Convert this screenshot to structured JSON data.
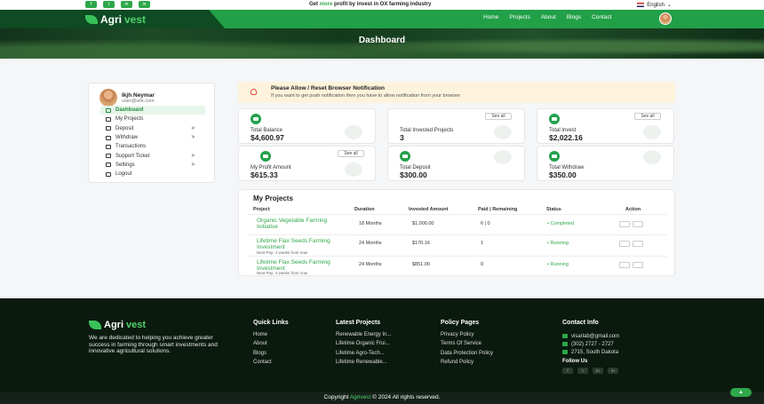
{
  "topbar": {
    "social": [
      "f",
      "t",
      "in",
      "in"
    ],
    "promo_prefix": "Get ",
    "promo_highlight": "more",
    "promo_suffix": " profit by invest in OX farming industry",
    "language": "English"
  },
  "nav": {
    "logo_a": "Agri",
    "logo_b": "vest",
    "links": [
      "Home",
      "Projects",
      "About",
      "Blogs",
      "Contact"
    ]
  },
  "hero": {
    "title": "Dashboard"
  },
  "sidebar": {
    "name": "Ikjh Neymar",
    "email": "user@site.com",
    "items": [
      {
        "label": "Dashboard",
        "chev": ""
      },
      {
        "label": "My Projects",
        "chev": ""
      },
      {
        "label": "Deposit",
        "chev": ">"
      },
      {
        "label": "Withdraw",
        "chev": ">"
      },
      {
        "label": "Transactions",
        "chev": ""
      },
      {
        "label": "Support Ticket",
        "chev": ">"
      },
      {
        "label": "Settings",
        "chev": ">"
      },
      {
        "label": "Logout",
        "chev": ""
      }
    ]
  },
  "alert": {
    "title": "Please Allow / Reset Browser Notification",
    "text": "If you want to get push notification then you have to allow notification from your browser"
  },
  "see_all": "See all",
  "cards": [
    {
      "label": "Total Balance",
      "value": "$4,600.97"
    },
    {
      "label": "Total Invested Projects",
      "value": "3"
    },
    {
      "label": "Total Invest",
      "value": "$2,022.16"
    },
    {
      "label": "My Profit Amount",
      "value": "$615.33"
    },
    {
      "label": "Total Deposit",
      "value": "$300.00"
    },
    {
      "label": "Total Withdraw",
      "value": "$350.00"
    }
  ],
  "projects": {
    "title": "My Projects",
    "headers": [
      "Project",
      "Duration",
      "Invested Amount",
      "Paid | Remaining",
      "Status",
      "Action"
    ],
    "rows": [
      {
        "name": "Organic Vegetable Farming Initiative",
        "next": "",
        "duration": "18 Months",
        "amount": "$1,000.00",
        "paid": "6 | 0",
        "status": "Completed"
      },
      {
        "name": "Lifetime Flax Seeds Farming Investment",
        "next": "Next Pay: 4 weeks from now",
        "duration": "24 Months",
        "amount": "$170.16",
        "paid": "1",
        "status": "Running"
      },
      {
        "name": "Lifetime Flax Seeds Farming Investment",
        "next": "Next Pay: 4 weeks from now",
        "duration": "24 Months",
        "amount": "$851.00",
        "paid": "0",
        "status": "Running"
      }
    ]
  },
  "footer": {
    "logo_a": "Agri",
    "logo_b": "vest",
    "description": "We are dedicated to helping you achieve greater success in farming through smart investments and innovative agricultural solutions.",
    "quick_links": {
      "title": "Quick Links",
      "items": [
        "Home",
        "About",
        "Blogs",
        "Contact"
      ]
    },
    "latest_projects": {
      "title": "Latest Projects",
      "items": [
        "Renewable Energy In...",
        "Lifetime Organic Frui...",
        "Lifetime Agro-Tech...",
        "Lifetime Renewable..."
      ]
    },
    "policy": {
      "title": "Policy Pages",
      "items": [
        "Privacy Policy",
        "Terms Of Service",
        "Data Protection Policy",
        "Refund Policy"
      ]
    },
    "contact": {
      "title": "Contact Info",
      "email": "visarlab@gmail.com",
      "phone": "(302) 2727 - 2727",
      "address": "2715, South Dakota",
      "follow": "Follow Us"
    },
    "copyright_a": "Copyright ",
    "copyright_b": "Agrivest",
    "copyright_c": " © 2024 All rights reserved."
  },
  "colors": {
    "brand_green": "#21a048",
    "dark_green": "#0e4a22",
    "footer_bg": "#0b1a0f"
  }
}
